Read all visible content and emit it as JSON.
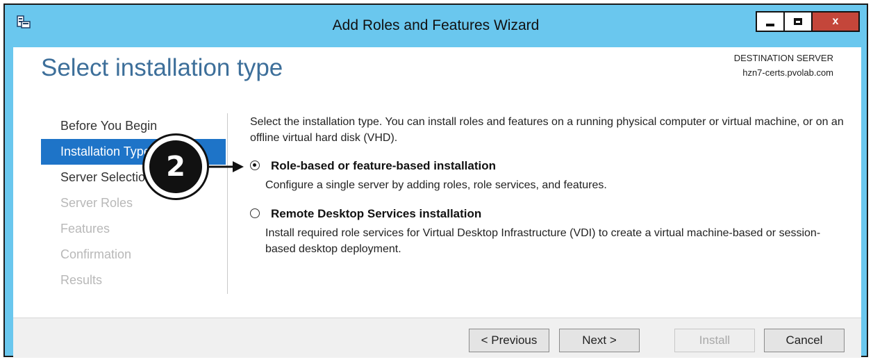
{
  "window": {
    "title": "Add Roles and Features Wizard",
    "close_label": "x"
  },
  "header": {
    "page_title": "Select installation type",
    "destination_label": "DESTINATION SERVER",
    "destination_server": "hzn7-certs.pvolab.com"
  },
  "nav": {
    "items": [
      {
        "label": "Before You Begin",
        "state": "normal"
      },
      {
        "label": "Installation Type",
        "state": "active"
      },
      {
        "label": "Server Selection",
        "state": "normal"
      },
      {
        "label": "Server Roles",
        "state": "disabled"
      },
      {
        "label": "Features",
        "state": "disabled"
      },
      {
        "label": "Confirmation",
        "state": "disabled"
      },
      {
        "label": "Results",
        "state": "disabled"
      }
    ]
  },
  "content": {
    "intro": "Select the installation type. You can install roles and features on a running physical computer or virtual machine, or on an offline virtual hard disk (VHD).",
    "options": [
      {
        "title": "Role-based or feature-based installation",
        "description": "Configure a single server by adding roles, role services, and features.",
        "selected": true
      },
      {
        "title": "Remote Desktop Services installation",
        "description": "Install required role services for Virtual Desktop Infrastructure (VDI) to create a virtual machine-based or session-based desktop deployment.",
        "selected": false
      }
    ]
  },
  "callout": {
    "number": "2"
  },
  "footer": {
    "previous_label": "< Previous",
    "next_label": "Next >",
    "install_label": "Install",
    "cancel_label": "Cancel"
  },
  "colors": {
    "titlebar": "#6ac7ee",
    "accent": "#1e74c8",
    "page_title": "#3d6f9a",
    "close_button": "#c4463a"
  },
  "icons": [
    "server-manager-icon",
    "minimize-icon",
    "maximize-icon",
    "close-icon",
    "radio-selected-icon",
    "radio-unselected-icon",
    "arrow-right-icon"
  ]
}
